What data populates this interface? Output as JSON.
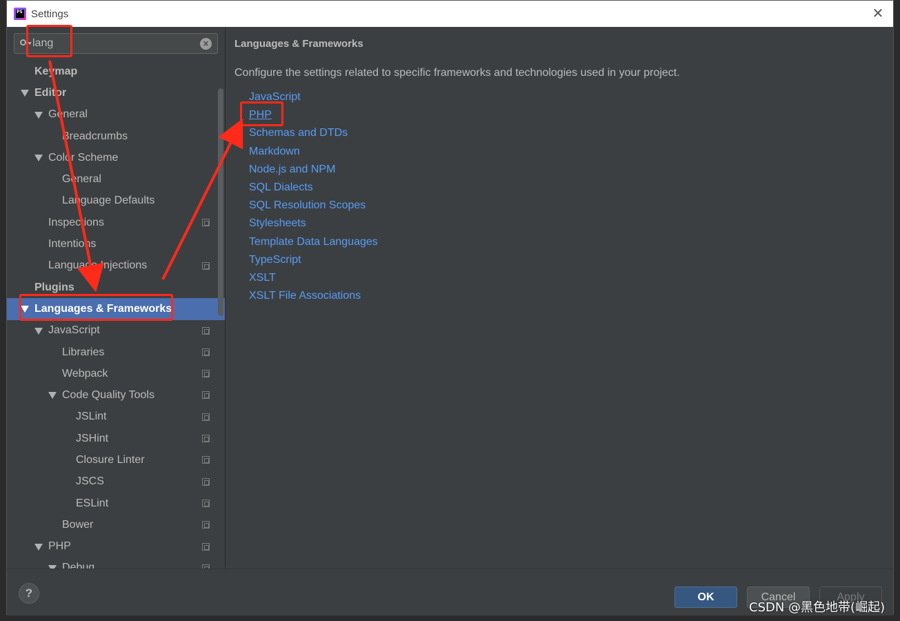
{
  "window": {
    "title": "Settings",
    "app_icon_text": "PS"
  },
  "search": {
    "value": "lang"
  },
  "sidebar": {
    "items": [
      {
        "label": "Keymap",
        "indent": 0,
        "bold": true,
        "expanded": false,
        "has_arrow": false,
        "copy": false,
        "selected": false,
        "name": "sidebar-item-keymap"
      },
      {
        "label": "Editor",
        "indent": 0,
        "bold": true,
        "expanded": true,
        "has_arrow": true,
        "copy": false,
        "selected": false,
        "name": "sidebar-item-editor"
      },
      {
        "label": "General",
        "indent": 1,
        "bold": false,
        "expanded": true,
        "has_arrow": true,
        "copy": false,
        "selected": false,
        "name": "sidebar-item-general"
      },
      {
        "label": "Breadcrumbs",
        "indent": 2,
        "bold": false,
        "has_arrow": false,
        "copy": false,
        "selected": false,
        "name": "sidebar-item-breadcrumbs"
      },
      {
        "label": "Color Scheme",
        "indent": 1,
        "bold": false,
        "expanded": true,
        "has_arrow": true,
        "copy": false,
        "selected": false,
        "name": "sidebar-item-color-scheme"
      },
      {
        "label": "General",
        "indent": 2,
        "bold": false,
        "has_arrow": false,
        "copy": false,
        "selected": false,
        "name": "sidebar-item-color-scheme-general"
      },
      {
        "label": "Language Defaults",
        "indent": 2,
        "bold": false,
        "has_arrow": false,
        "copy": false,
        "selected": false,
        "name": "sidebar-item-language-defaults"
      },
      {
        "label": "Inspections",
        "indent": 1,
        "bold": false,
        "has_arrow": false,
        "copy": true,
        "selected": false,
        "name": "sidebar-item-inspections"
      },
      {
        "label": "Intentions",
        "indent": 1,
        "bold": false,
        "has_arrow": false,
        "copy": false,
        "selected": false,
        "name": "sidebar-item-intentions"
      },
      {
        "label": "Language Injections",
        "indent": 1,
        "bold": false,
        "has_arrow": false,
        "copy": true,
        "selected": false,
        "name": "sidebar-item-language-injections"
      },
      {
        "label": "Plugins",
        "indent": 0,
        "bold": true,
        "has_arrow": false,
        "copy": false,
        "selected": false,
        "name": "sidebar-item-plugins"
      },
      {
        "label": "Languages & Frameworks",
        "indent": 0,
        "bold": true,
        "expanded": true,
        "has_arrow": true,
        "copy": false,
        "selected": true,
        "name": "sidebar-item-languages-frameworks"
      },
      {
        "label": "JavaScript",
        "indent": 1,
        "bold": false,
        "expanded": true,
        "has_arrow": true,
        "copy": true,
        "selected": false,
        "name": "sidebar-item-javascript"
      },
      {
        "label": "Libraries",
        "indent": 2,
        "bold": false,
        "has_arrow": false,
        "copy": true,
        "selected": false,
        "name": "sidebar-item-libraries"
      },
      {
        "label": "Webpack",
        "indent": 2,
        "bold": false,
        "has_arrow": false,
        "copy": true,
        "selected": false,
        "name": "sidebar-item-webpack"
      },
      {
        "label": "Code Quality Tools",
        "indent": 2,
        "bold": false,
        "expanded": true,
        "has_arrow": true,
        "copy": true,
        "selected": false,
        "name": "sidebar-item-code-quality-tools"
      },
      {
        "label": "JSLint",
        "indent": 3,
        "bold": false,
        "has_arrow": false,
        "copy": true,
        "selected": false,
        "name": "sidebar-item-jslint"
      },
      {
        "label": "JSHint",
        "indent": 3,
        "bold": false,
        "has_arrow": false,
        "copy": true,
        "selected": false,
        "name": "sidebar-item-jshint"
      },
      {
        "label": "Closure Linter",
        "indent": 3,
        "bold": false,
        "has_arrow": false,
        "copy": true,
        "selected": false,
        "name": "sidebar-item-closure-linter"
      },
      {
        "label": "JSCS",
        "indent": 3,
        "bold": false,
        "has_arrow": false,
        "copy": true,
        "selected": false,
        "name": "sidebar-item-jscs"
      },
      {
        "label": "ESLint",
        "indent": 3,
        "bold": false,
        "has_arrow": false,
        "copy": true,
        "selected": false,
        "name": "sidebar-item-eslint"
      },
      {
        "label": "Bower",
        "indent": 2,
        "bold": false,
        "has_arrow": false,
        "copy": true,
        "selected": false,
        "name": "sidebar-item-bower"
      },
      {
        "label": "PHP",
        "indent": 1,
        "bold": false,
        "expanded": true,
        "has_arrow": true,
        "copy": true,
        "selected": false,
        "name": "sidebar-item-php"
      },
      {
        "label": "Debug",
        "indent": 2,
        "bold": false,
        "expanded": true,
        "has_arrow": true,
        "copy": true,
        "selected": false,
        "name": "sidebar-item-debug"
      }
    ]
  },
  "content": {
    "title": "Languages & Frameworks",
    "description": "Configure the settings related to specific frameworks and technologies used in your project.",
    "links": [
      {
        "label": "JavaScript",
        "name": "link-javascript",
        "underline": false
      },
      {
        "label": "PHP",
        "name": "link-php",
        "underline": true
      },
      {
        "label": "Schemas and DTDs",
        "name": "link-schemas-dtds",
        "underline": false
      },
      {
        "label": "Markdown",
        "name": "link-markdown",
        "underline": false
      },
      {
        "label": "Node.js and NPM",
        "name": "link-nodejs-npm",
        "underline": false
      },
      {
        "label": "SQL Dialects",
        "name": "link-sql-dialects",
        "underline": false
      },
      {
        "label": "SQL Resolution Scopes",
        "name": "link-sql-resolution-scopes",
        "underline": false
      },
      {
        "label": "Stylesheets",
        "name": "link-stylesheets",
        "underline": false
      },
      {
        "label": "Template Data Languages",
        "name": "link-template-data-languages",
        "underline": false
      },
      {
        "label": "TypeScript",
        "name": "link-typescript",
        "underline": false
      },
      {
        "label": "XSLT",
        "name": "link-xslt",
        "underline": false
      },
      {
        "label": "XSLT File Associations",
        "name": "link-xslt-file-associations",
        "underline": false
      }
    ]
  },
  "footer": {
    "help_label": "?",
    "ok_label": "OK",
    "cancel_label": "Cancel",
    "apply_label": "Apply"
  },
  "watermark": "CSDN @黑色地带(崛起)",
  "colors": {
    "selection": "#4b6eaf",
    "link": "#589df6",
    "annotation": "#ff2a1a",
    "background": "#3c3f41"
  }
}
